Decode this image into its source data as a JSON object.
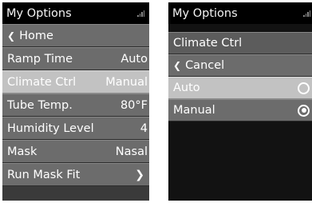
{
  "left_screen": {
    "title": "My Options",
    "home_label": "Home",
    "items": [
      {
        "label": "Ramp Time",
        "value": "Auto"
      },
      {
        "label": "Climate Ctrl",
        "value": "Manual"
      },
      {
        "label": "Tube Temp.",
        "value": "80°F"
      },
      {
        "label": "Humidity Level",
        "value": "4"
      },
      {
        "label": "Mask",
        "value": "Nasal"
      },
      {
        "label": "Run Mask Fit",
        "value": ""
      }
    ],
    "selected_item": "Climate Ctrl"
  },
  "right_screen": {
    "title": "My Options",
    "submenu_title": "Climate Ctrl",
    "cancel_label": "Cancel",
    "options": [
      {
        "label": "Auto",
        "selected": false
      },
      {
        "label": "Manual",
        "selected": true
      }
    ]
  },
  "icons": {
    "back": "chevron-left-icon",
    "forward": "chevron-right-icon",
    "signal": "signal-strength-icon",
    "radio_off": "radio-unselected-icon",
    "radio_on": "radio-selected-icon"
  },
  "colors": {
    "titlebar": "#000000",
    "row": "#6c6c6c",
    "row_selected": "#c2c2c2",
    "right_background": "#121212",
    "text": "#ffffff"
  }
}
